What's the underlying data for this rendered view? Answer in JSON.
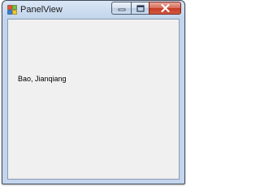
{
  "window": {
    "title": "PanelView",
    "icon": "windows-form-icon",
    "caption_buttons": [
      "minimize-icon",
      "maximize-icon",
      "close-icon"
    ]
  },
  "content": {
    "label": "Bao, Jianqiang"
  },
  "colors": {
    "client_background": "#f0f0f0",
    "close_button": "#c53a23"
  }
}
